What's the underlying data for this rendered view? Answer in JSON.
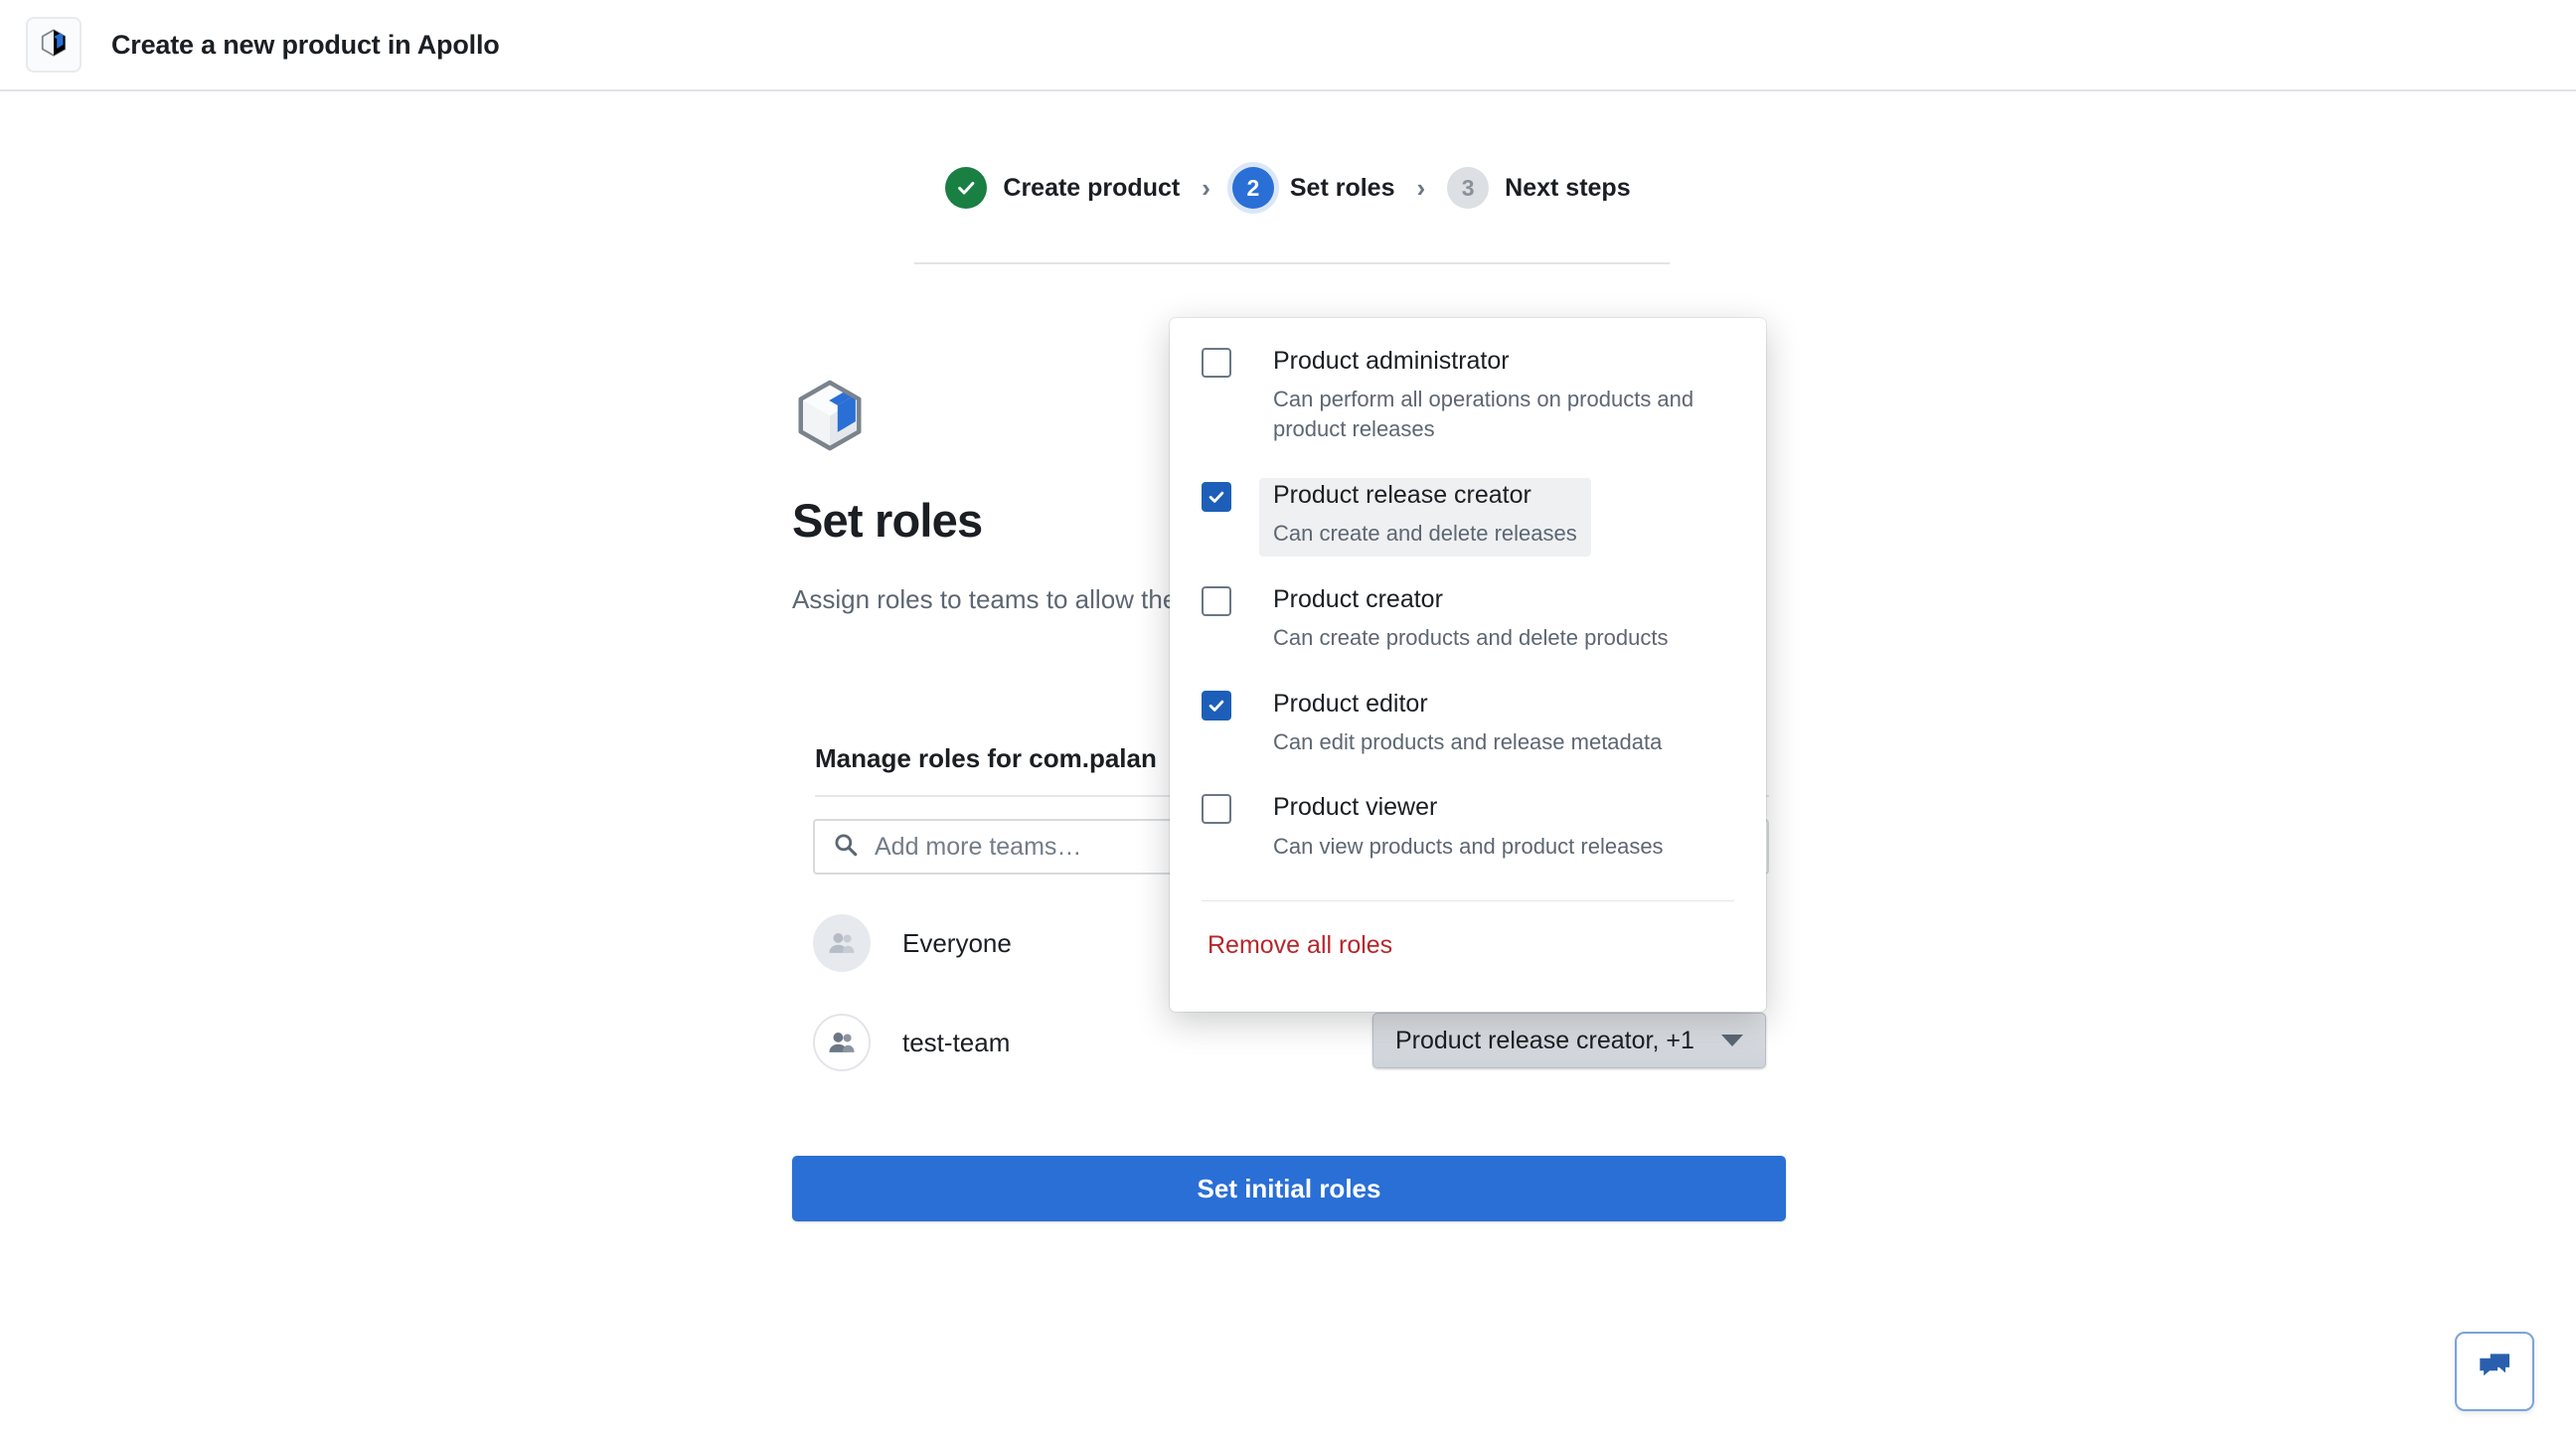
{
  "topbar": {
    "app_icon": "product-box-icon",
    "title": "Create a new product in Apollo"
  },
  "stepper": {
    "steps": [
      {
        "marker": "✓",
        "label": "Create product",
        "state": "done"
      },
      {
        "marker": "2",
        "label": "Set roles",
        "state": "current"
      },
      {
        "marker": "3",
        "label": "Next steps",
        "state": "todo"
      }
    ],
    "separator": "›"
  },
  "main": {
    "icon": "product-box-icon",
    "heading": "Set roles",
    "subtitle": "Assign roles to teams to allow them to use this product.",
    "manage_title": "Manage roles for com.palan",
    "search": {
      "placeholder": "Add more teams…",
      "icon": "search-icon",
      "value": ""
    },
    "teams": [
      {
        "name": "Everyone",
        "avatar": "group-icon",
        "avatar_style": "filled"
      },
      {
        "name": "test-team",
        "avatar": "group-icon",
        "avatar_style": "outline"
      }
    ],
    "role_select": {
      "label": "Product release creator, +1",
      "icon": "chevron-down-icon"
    },
    "submit_label": "Set initial roles"
  },
  "roles_popover": {
    "items": [
      {
        "name": "Product administrator",
        "desc": "Can perform all operations on products and product releases",
        "checked": false,
        "highlighted": false
      },
      {
        "name": "Product release creator",
        "desc": "Can create and delete releases",
        "checked": true,
        "highlighted": true
      },
      {
        "name": "Product creator",
        "desc": "Can create products and delete products",
        "checked": false,
        "highlighted": false
      },
      {
        "name": "Product editor",
        "desc": "Can edit products and release metadata",
        "checked": true,
        "highlighted": false
      },
      {
        "name": "Product viewer",
        "desc": "Can view products and product releases",
        "checked": false,
        "highlighted": false
      }
    ],
    "remove_all_label": "Remove all roles"
  },
  "chat": {
    "icon": "chat-bubbles-icon"
  },
  "colors": {
    "accent_blue": "#2a6fd6",
    "checkbox_blue": "#1d5fb8",
    "done_green": "#1a7f43",
    "danger_red": "#b7272b",
    "text": "#1b1f23",
    "muted_text": "#5c6773",
    "highlight_bg": "#eef0f2"
  }
}
